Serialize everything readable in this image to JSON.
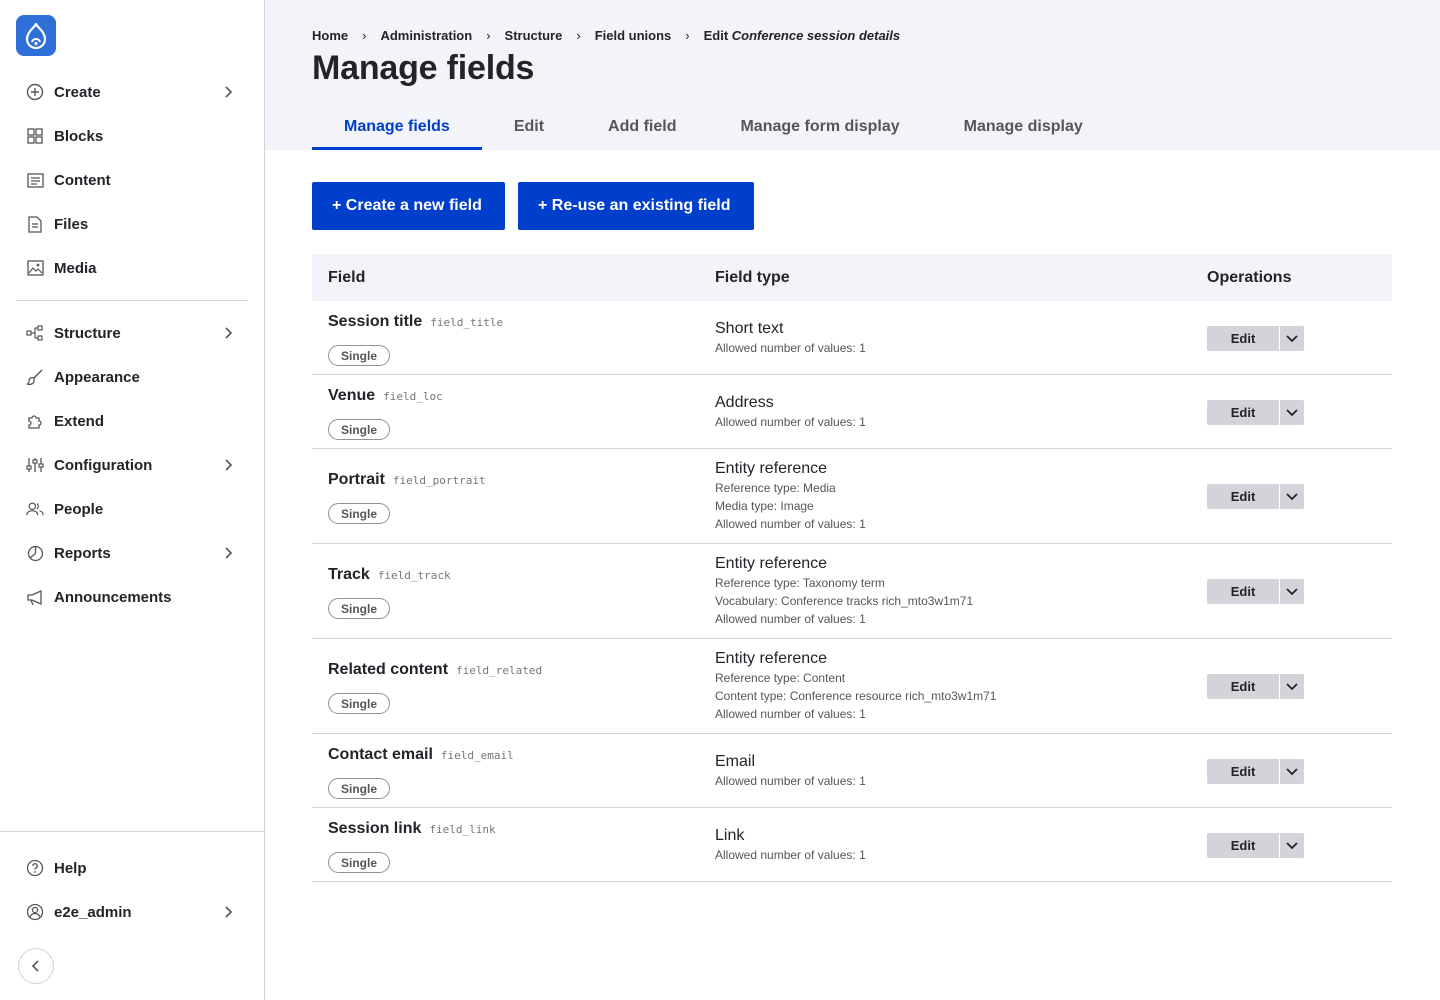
{
  "sidebar": {
    "items": [
      {
        "label": "Create",
        "icon": "plus-circle-icon"
      },
      {
        "label": "Blocks",
        "icon": "blocks-icon"
      },
      {
        "label": "Content",
        "icon": "content-icon"
      },
      {
        "label": "Files",
        "icon": "file-icon"
      },
      {
        "label": "Media",
        "icon": "media-icon"
      },
      {
        "label": "Structure",
        "icon": "structure-icon"
      },
      {
        "label": "Appearance",
        "icon": "brush-icon"
      },
      {
        "label": "Extend",
        "icon": "puzzle-icon"
      },
      {
        "label": "Configuration",
        "icon": "sliders-icon"
      },
      {
        "label": "People",
        "icon": "people-icon"
      },
      {
        "label": "Reports",
        "icon": "chart-icon"
      },
      {
        "label": "Announcements",
        "icon": "megaphone-icon"
      }
    ],
    "help": "Help",
    "user": "e2e_admin"
  },
  "breadcrumb": {
    "items": [
      "Home",
      "Administration",
      "Structure",
      "Field unions"
    ],
    "current_prefix": "Edit",
    "current_name": "Conference session details"
  },
  "page": {
    "title": "Manage fields"
  },
  "tabs": [
    "Manage fields",
    "Edit",
    "Add field",
    "Manage form display",
    "Manage display"
  ],
  "actions": {
    "create": "+ Create a new field",
    "reuse": "+ Re-use an existing field"
  },
  "table": {
    "headers": [
      "Field",
      "Field type",
      "Operations"
    ],
    "rows": [
      {
        "label": "Session title",
        "machine": "field_title",
        "badge": "Single",
        "type": "Short text",
        "details": [
          "Allowed number of values: 1"
        ],
        "op": "Edit"
      },
      {
        "label": "Venue",
        "machine": "field_loc",
        "badge": "Single",
        "type": "Address",
        "details": [
          "Allowed number of values: 1"
        ],
        "op": "Edit"
      },
      {
        "label": "Portrait",
        "machine": "field_portrait",
        "badge": "Single",
        "type": "Entity reference",
        "details": [
          "Reference type: Media",
          "Media type: Image",
          "Allowed number of values: 1"
        ],
        "op": "Edit"
      },
      {
        "label": "Track",
        "machine": "field_track",
        "badge": "Single",
        "type": "Entity reference",
        "details": [
          "Reference type: Taxonomy term",
          "Vocabulary: Conference tracks rich_mto3w1m71",
          "Allowed number of values: 1"
        ],
        "op": "Edit"
      },
      {
        "label": "Related content",
        "machine": "field_related",
        "badge": "Single",
        "type": "Entity reference",
        "details": [
          "Reference type: Content",
          "Content type: Conference resource rich_mto3w1m71",
          "Allowed number of values: 1"
        ],
        "op": "Edit"
      },
      {
        "label": "Contact email",
        "machine": "field_email",
        "badge": "Single",
        "type": "Email",
        "details": [
          "Allowed number of values: 1"
        ],
        "op": "Edit"
      },
      {
        "label": "Session link",
        "machine": "field_link",
        "badge": "Single",
        "type": "Link",
        "details": [
          "Allowed number of values: 1"
        ],
        "op": "Edit"
      }
    ]
  },
  "colors": {
    "accent": "#003ecc",
    "header_bg": "#f3f4f9",
    "logo": "#2f6fd8",
    "button_gray": "#d3d4d9"
  }
}
